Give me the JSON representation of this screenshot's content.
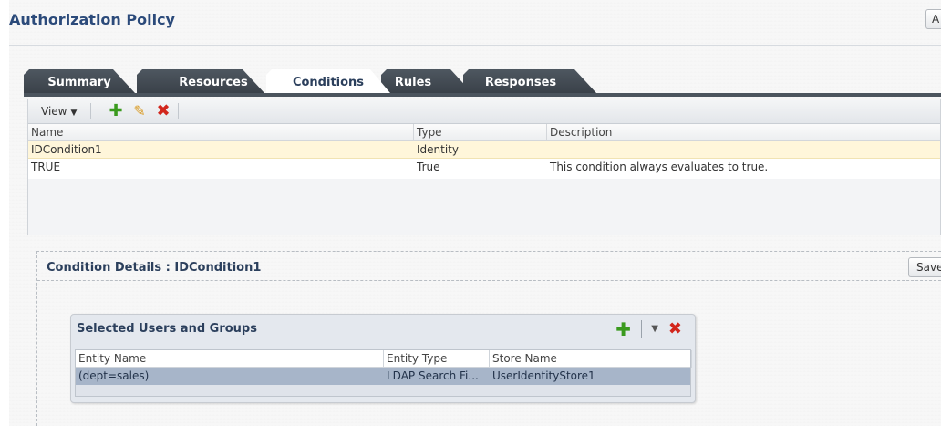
{
  "header": {
    "title": "Authorization Policy",
    "top_right_button": "A"
  },
  "tabs": [
    {
      "label": "Summary",
      "active": false
    },
    {
      "label": "Resources",
      "active": false
    },
    {
      "label": "Conditions",
      "active": true
    },
    {
      "label": "Rules",
      "active": false
    },
    {
      "label": "Responses",
      "active": false
    }
  ],
  "toolbar": {
    "view_label": "View",
    "icons": [
      "add-icon",
      "edit-icon",
      "delete-icon"
    ]
  },
  "conditions_table": {
    "columns": [
      "Name",
      "Type",
      "Description"
    ],
    "rows": [
      {
        "name": "IDCondition1",
        "type": "Identity",
        "description": ""
      },
      {
        "name": "TRUE",
        "type": "True",
        "description": "This condition always evaluates to true."
      }
    ]
  },
  "details": {
    "title": "Condition Details : IDCondition1",
    "save_label": "Save",
    "users_box": {
      "title": "Selected Users and Groups",
      "columns": [
        "Entity Name",
        "Entity Type",
        "Store Name"
      ],
      "rows": [
        {
          "entity_name": "(dept=sales)",
          "entity_type": "LDAP Search Fi...",
          "store_name": "UserIdentityStore1"
        }
      ]
    }
  },
  "colors": {
    "title_blue": "#2b4a7a",
    "tab_dark": "#3a4149",
    "selected_row": "#fff6da",
    "selected_user_row": "#a7b5c9",
    "add_green": "#3a9a1e",
    "delete_red": "#d2261c"
  }
}
